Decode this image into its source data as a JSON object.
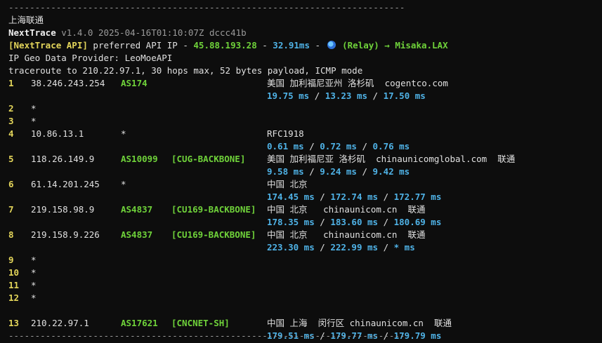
{
  "separator_top": "---------------------------------------------------------------------------",
  "separator_bottom": "---------------------------------------------------------------------------",
  "location": "上海联通",
  "version": {
    "name": "NextTrace",
    "info": "v1.4.0 2025-04-16T01:10:07Z dccc41b"
  },
  "api": {
    "tag": "[NextTrace API]",
    "text": " preferred API IP - ",
    "ip": "45.88.193.28",
    "dash": " - ",
    "latency": "32.91ms",
    "dash2": " - ",
    "relay": "(Relay) → Misaka.LAX"
  },
  "geo_provider": "IP Geo Data Provider: LeoMoeAPI",
  "traceroute_header": "traceroute to 210.22.97.1, 30 hops max, 52 bytes payload, ICMP mode",
  "hops": [
    {
      "num": "1",
      "ip": "38.246.243.254",
      "asn": "AS174",
      "tag": "",
      "geo": "美国 加利福尼亚州 洛杉矶  cogentco.com",
      "rtt": [
        "19.75 ms",
        "13.23 ms",
        "17.50 ms"
      ]
    },
    {
      "num": "2",
      "ip": "*",
      "asn": "",
      "tag": "",
      "geo": "",
      "rtt": []
    },
    {
      "num": "3",
      "ip": "*",
      "asn": "",
      "tag": "",
      "geo": "",
      "rtt": []
    },
    {
      "num": "4",
      "ip": "10.86.13.1",
      "asn": "*",
      "tag": "",
      "geo": "RFC1918",
      "rtt": [
        "0.61 ms",
        "0.72 ms",
        "0.76 ms"
      ]
    },
    {
      "num": "5",
      "ip": "118.26.149.9",
      "asn": "AS10099",
      "tag": "[CUG-BACKBONE]",
      "geo": "美国 加利福尼亚 洛杉矶  chinaunicomglobal.com  联通",
      "rtt": [
        "9.58 ms",
        "9.24 ms",
        "9.42 ms"
      ]
    },
    {
      "num": "6",
      "ip": "61.14.201.245",
      "asn": "*",
      "tag": "",
      "geo": "中国 北京",
      "rtt": [
        "174.45 ms",
        "172.74 ms",
        "172.77 ms"
      ]
    },
    {
      "num": "7",
      "ip": "219.158.98.9",
      "asn": "AS4837",
      "tag": "[CU169-BACKBONE]",
      "geo": "中国 北京   chinaunicom.cn  联通",
      "rtt": [
        "178.35 ms",
        "183.60 ms",
        "180.69 ms"
      ]
    },
    {
      "num": "8",
      "ip": "219.158.9.226",
      "asn": "AS4837",
      "tag": "[CU169-BACKBONE]",
      "geo": "中国 北京   chinaunicom.cn  联通",
      "rtt": [
        "223.30 ms",
        "222.99 ms",
        "* ms"
      ]
    },
    {
      "num": "9",
      "ip": "*",
      "asn": "",
      "tag": "",
      "geo": "",
      "rtt": []
    },
    {
      "num": "10",
      "ip": "*",
      "asn": "",
      "tag": "",
      "geo": "",
      "rtt": []
    },
    {
      "num": "11",
      "ip": "*",
      "asn": "",
      "tag": "",
      "geo": "",
      "rtt": []
    },
    {
      "num": "12",
      "ip": "*",
      "asn": "",
      "tag": "",
      "geo": "",
      "rtt": []
    },
    {
      "num": "13",
      "ip": "210.22.97.1",
      "asn": "AS17621",
      "tag": "[CNCNET-SH]",
      "geo": "中国 上海  闵行区 chinaunicom.cn  联通",
      "rtt": [
        "179.51 ms",
        "179.77 ms",
        "179.79 ms"
      ]
    }
  ],
  "rtt_separator": " / ",
  "colors": {
    "background": "#0d0d0d",
    "hop_number": "#e3d55a",
    "asn": "#6fd23a",
    "rtt": "#4fb2e6"
  }
}
